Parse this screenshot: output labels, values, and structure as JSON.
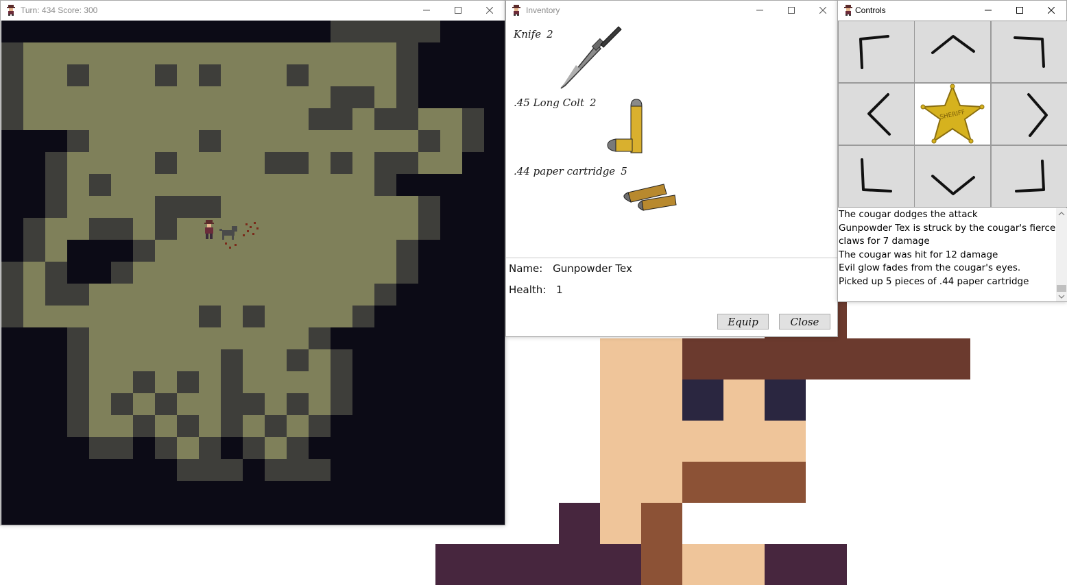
{
  "game_window": {
    "title": "Turn: 434 Score: 300",
    "turn": 434,
    "score": 300
  },
  "inventory_window": {
    "title": "Inventory",
    "items": [
      {
        "name": "Knife",
        "qty": "2",
        "icon": "knife-icon"
      },
      {
        "name": ".45 Long Colt",
        "qty": "2",
        "icon": "bullet-icon"
      },
      {
        "name": ".44 paper cartridge",
        "qty": "5",
        "icon": "paper-cartridge-icon"
      }
    ],
    "name_label": "Name:",
    "name_value": "Gunpowder Tex",
    "health_label": "Health:",
    "health_value": "1",
    "equip_label": "Equip",
    "close_label": "Close"
  },
  "controls_window": {
    "title": "Controls",
    "buttons": [
      "up-left-arrow-icon",
      "up-arrow-icon",
      "up-right-arrow-icon",
      "left-arrow-icon",
      "sheriff-star-icon",
      "right-arrow-icon",
      "down-left-arrow-icon",
      "down-arrow-icon",
      "down-right-arrow-icon"
    ],
    "star_text": "SHERIFF",
    "log": [
      "The cougar dodges the attack",
      "Gunpowder Tex is struck by the cougar's fierce claws for 7 damage",
      "The cougar was hit for 12 damage",
      "Evil glow fades from the cougar's eyes.",
      "Picked up 5 pieces of .44 paper cartridge"
    ]
  },
  "colors": {
    "floor": "#7f805a",
    "wall": "#3e3e3a",
    "void": "#0c0b16",
    "skin": "#efc59a",
    "hat": "#6b3a2e",
    "eye": "#2a2640",
    "mustache": "#8c5236",
    "coat": "#47263e"
  }
}
